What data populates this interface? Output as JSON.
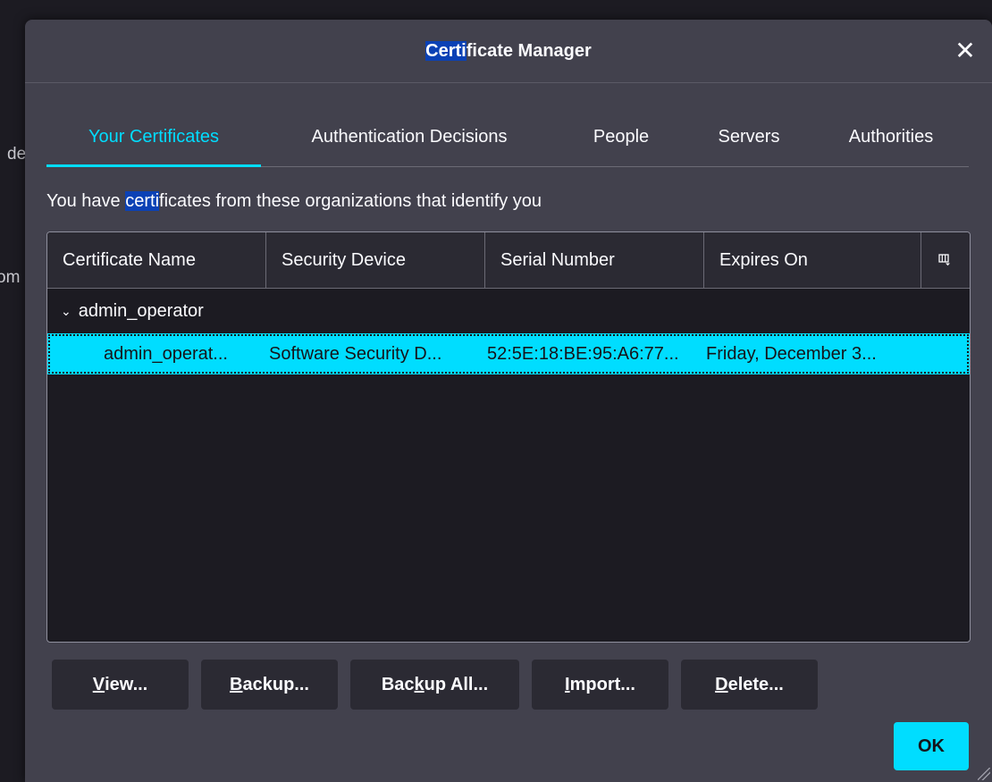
{
  "background": {
    "text_1": "de",
    "text_2": "om"
  },
  "dialog": {
    "title_highlight": "Certi",
    "title_rest": "ficate Manager",
    "close_glyph": "✕",
    "tabs": [
      {
        "label": "Your Certificates",
        "active": true
      },
      {
        "label": "Authentication Decisions",
        "active": false
      },
      {
        "label": "People",
        "active": false
      },
      {
        "label": "Servers",
        "active": false
      },
      {
        "label": "Authorities",
        "active": false
      }
    ],
    "description": {
      "before": "You have ",
      "highlight": "certi",
      "after": "ficates from these organizations that identify you"
    },
    "table": {
      "columns": [
        "Certificate Name",
        "Security Device",
        "Serial Number",
        "Expires On"
      ],
      "column_picker_icon": "column-picker-icon",
      "groups": [
        {
          "name": "admin_operator",
          "expanded": true,
          "rows": [
            {
              "name": "admin_operat...",
              "device": "Software Security D...",
              "serial": "52:5E:18:BE:95:A6:77...",
              "expires": "Friday, December 3..."
            }
          ]
        }
      ]
    },
    "buttons": {
      "view": {
        "key": "V",
        "rest": "iew..."
      },
      "backup": {
        "key": "B",
        "rest": "ackup..."
      },
      "backup_all": {
        "pre": "Bac",
        "key": "k",
        "rest": "up All..."
      },
      "import": {
        "key": "I",
        "rest": "mport..."
      },
      "delete": {
        "key": "D",
        "rest": "elete..."
      }
    },
    "ok_label": "OK"
  },
  "colors": {
    "accent": "#00ddff",
    "dialog_bg": "#42414d",
    "tree_bg": "#1c1b22",
    "find_highlight": "#0b41b5"
  }
}
